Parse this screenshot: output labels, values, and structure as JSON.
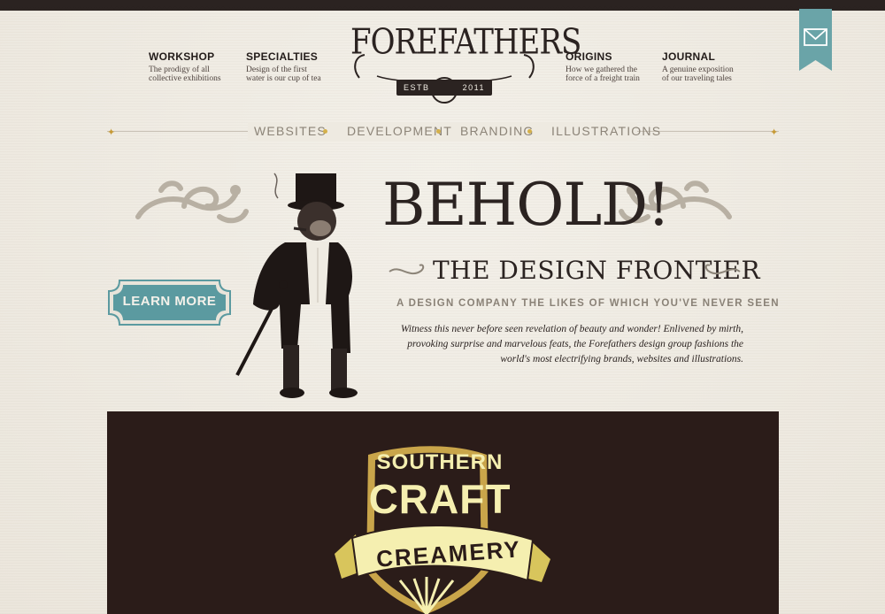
{
  "nav": {
    "left": [
      {
        "title": "WORKSHOP",
        "sub1": "The prodigy of all",
        "sub2": "collective exhibitions"
      },
      {
        "title": "SPECIALTIES",
        "sub1": "Design of the first",
        "sub2": "water is our cup of tea"
      }
    ],
    "right": [
      {
        "title": "ORIGINS",
        "sub1": "How we gathered the",
        "sub2": "force of a freight train"
      },
      {
        "title": "JOURNAL",
        "sub1": "A genuine exposition",
        "sub2": "of our traveling tales"
      }
    ]
  },
  "logo": {
    "word": "FOREFATHERS",
    "estb": "ESTB",
    "year": "2011"
  },
  "subnav": [
    "WEBSITES",
    "DEVELOPMENT",
    "BRANDING",
    "ILLUSTRATIONS"
  ],
  "hero": {
    "title": "BEHOLD!",
    "subtitle": "THE DESIGN FRONTIER",
    "tagline": "A DESIGN COMPANY THE LIKES OF WHICH YOU'VE NEVER SEEN",
    "body": "Witness this never before seen revelation of beauty and wonder! Enlivened by mirth, provoking surprise and marvelous feats, the Forefathers design group fashions the world's most electrifying brands, websites and illustrations.",
    "cta": "LEARN MORE"
  },
  "showcase": {
    "line1": "SOUTHERN",
    "line2": "CRAFT",
    "line3": "CREAMERY"
  },
  "colors": {
    "background": "#efebe2",
    "ink": "#2b2321",
    "teal": "#5b9aa0",
    "gold": "#d4b04a",
    "cream_badge": "#f5efb0",
    "dark_panel": "#2b1c19"
  },
  "icons": {
    "mail": "envelope-icon",
    "star": "star-icon",
    "dot": "dot-icon"
  }
}
